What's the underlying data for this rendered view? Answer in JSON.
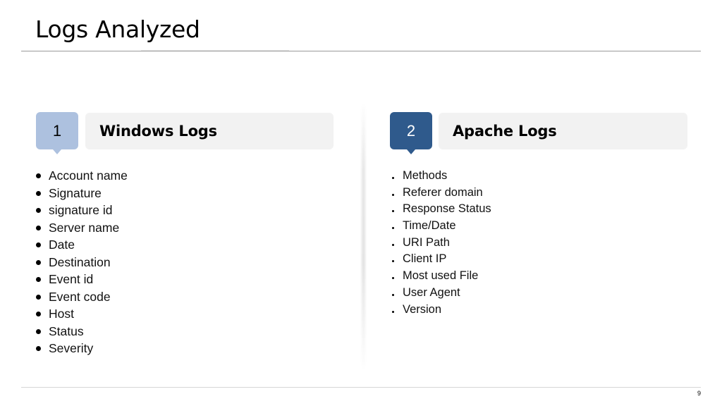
{
  "slide": {
    "title": "Logs Analyzed",
    "page_number": "9"
  },
  "left": {
    "number": "1",
    "heading": "Windows Logs",
    "items": [
      "Account name",
      "Signature",
      "signature id",
      "Server name",
      "Date",
      "Destination",
      "Event id",
      "Event code",
      "Host",
      "Status",
      "Severity"
    ]
  },
  "right": {
    "number": "2",
    "heading": "Apache Logs",
    "items": [
      "Methods",
      "Referer domain",
      "Response Status",
      "Time/Date",
      "URI Path",
      "Client IP",
      "Most used File",
      "User Agent",
      "Version"
    ]
  },
  "colors": {
    "box_1": "#adc1df",
    "box_2": "#2f5a8c",
    "heading_bg": "#f2f2f2"
  }
}
